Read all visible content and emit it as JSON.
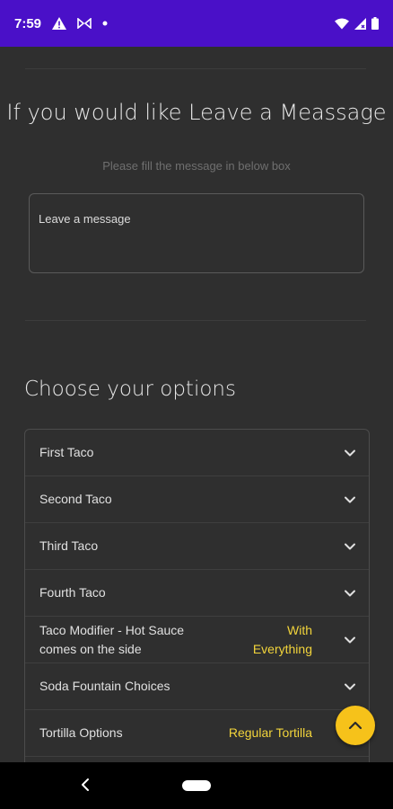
{
  "status_bar": {
    "time": "7:59"
  },
  "message_section": {
    "title": "If you would like Leave a Meassage",
    "subtitle": "Please fill the message in below box",
    "message_placeholder": "Leave a message"
  },
  "options_section": {
    "title": "Choose your options",
    "items": [
      {
        "label": "First Taco",
        "value": ""
      },
      {
        "label": "Second Taco",
        "value": ""
      },
      {
        "label": "Third Taco",
        "value": ""
      },
      {
        "label": "Fourth Taco",
        "value": ""
      },
      {
        "label": "Taco Modifier - Hot Sauce comes on the side",
        "value": "With Everything"
      },
      {
        "label": "Soda Fountain Choices",
        "value": ""
      },
      {
        "label": "Tortilla Options",
        "value": "Regular Tortilla"
      }
    ]
  },
  "colors": {
    "status_bar": "#4a10c8",
    "background": "#2f2f2f",
    "accent": "#f6c21a",
    "value_text": "#f2d43b"
  },
  "icons": {
    "status": [
      "warning-icon",
      "cast-icon",
      "dot-icon",
      "wifi-icon",
      "signal-icon",
      "battery-icon"
    ],
    "row": "chevron-down-icon",
    "fab": "chevron-up-icon",
    "nav": [
      "back-icon",
      "home-pill"
    ]
  }
}
